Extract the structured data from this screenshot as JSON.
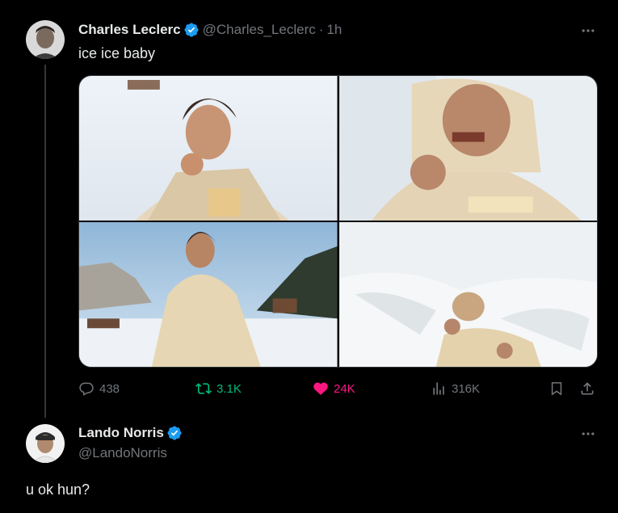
{
  "main_tweet": {
    "author_name": "Charles Leclerc",
    "handle": "@Charles_Leclerc",
    "separator": "·",
    "time": "1h",
    "text": "ice ice baby",
    "media_count": 4,
    "stats": {
      "replies": "438",
      "retweets": "3.1K",
      "likes": "24K",
      "views": "316K"
    }
  },
  "reply_tweet": {
    "author_name": "Lando Norris",
    "handle": "@LandoNorris",
    "text": "u ok hun?"
  },
  "colors": {
    "background": "#000000",
    "text": "#e7e9ea",
    "muted": "#71767b",
    "verified": "#1d9bf0",
    "retweet_active": "#00ba7c",
    "like_active": "#f91880"
  }
}
